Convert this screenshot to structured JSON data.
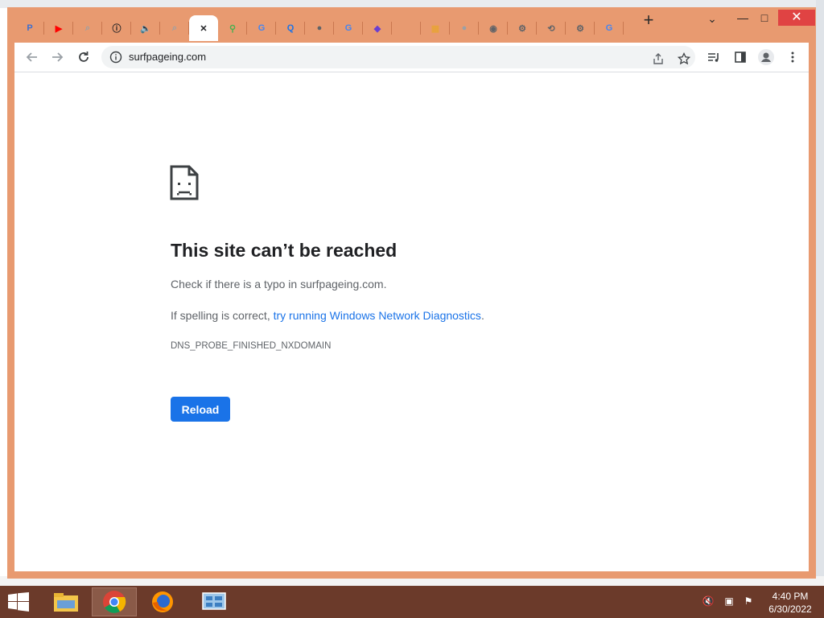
{
  "browser": {
    "tabs": [
      {
        "icon": "puzzle-icon",
        "color": "#3b6fd1",
        "symbol": "P"
      },
      {
        "icon": "youtube-icon",
        "color": "#ff0000",
        "symbol": "▶"
      },
      {
        "icon": "search-icon",
        "color": "#9aa0a6",
        "symbol": "⌕"
      },
      {
        "icon": "info-icon",
        "color": "#202124",
        "symbol": "ⓘ"
      },
      {
        "icon": "audio-icon",
        "color": "#202124",
        "symbol": "🔈"
      },
      {
        "icon": "search-icon",
        "color": "#9aa0a6",
        "symbol": "⌕"
      },
      {
        "icon": "close-icon",
        "color": "#202124",
        "symbol": "✕",
        "active": true
      },
      {
        "icon": "pin-icon",
        "color": "#4caf50",
        "symbol": "⚲"
      },
      {
        "icon": "google-icon",
        "color": "#4285f4",
        "symbol": "G"
      },
      {
        "icon": "search-icon",
        "color": "#1a73e8",
        "symbol": "Q"
      },
      {
        "icon": "globe-icon",
        "color": "#5f6368",
        "symbol": "●"
      },
      {
        "icon": "google-icon",
        "color": "#4285f4",
        "symbol": "G"
      },
      {
        "icon": "shield-icon",
        "color": "#6a3fd1",
        "symbol": "◆"
      },
      {
        "icon": "blank-icon",
        "color": "#e89a70",
        "symbol": ""
      },
      {
        "icon": "app-icon",
        "color": "#e8a33a",
        "symbol": "▦"
      },
      {
        "icon": "globe-icon",
        "color": "#9aa0a6",
        "symbol": "●"
      },
      {
        "icon": "chrome-icon",
        "color": "#5f6368",
        "symbol": "◉"
      },
      {
        "icon": "gear-icon",
        "color": "#5f6368",
        "symbol": "⚙"
      },
      {
        "icon": "history-icon",
        "color": "#5f6368",
        "symbol": "⟲"
      },
      {
        "icon": "gear-icon",
        "color": "#5f6368",
        "symbol": "⚙"
      },
      {
        "icon": "google-icon",
        "color": "#4285f4",
        "symbol": "G"
      }
    ],
    "url": "surfpageing.com"
  },
  "error": {
    "title": "This site can’t be reached",
    "line1": "Check if there is a typo in surfpageing.com.",
    "line2_prefix": "If spelling is correct, ",
    "line2_link": "try running Windows Network Diagnostics",
    "line2_suffix": ".",
    "code": "DNS_PROBE_FINISHED_NXDOMAIN",
    "reload_label": "Reload"
  },
  "taskbar": {
    "apps": [
      {
        "name": "file-explorer-icon",
        "active": false
      },
      {
        "name": "chrome-icon",
        "active": true
      },
      {
        "name": "firefox-icon",
        "active": false
      },
      {
        "name": "control-panel-icon",
        "active": false
      }
    ],
    "time": "4:40 PM",
    "date": "6/30/2022"
  },
  "colors": {
    "frame": "#e89a70",
    "accent": "#1a73e8",
    "taskbar": "#6b3a2a"
  }
}
